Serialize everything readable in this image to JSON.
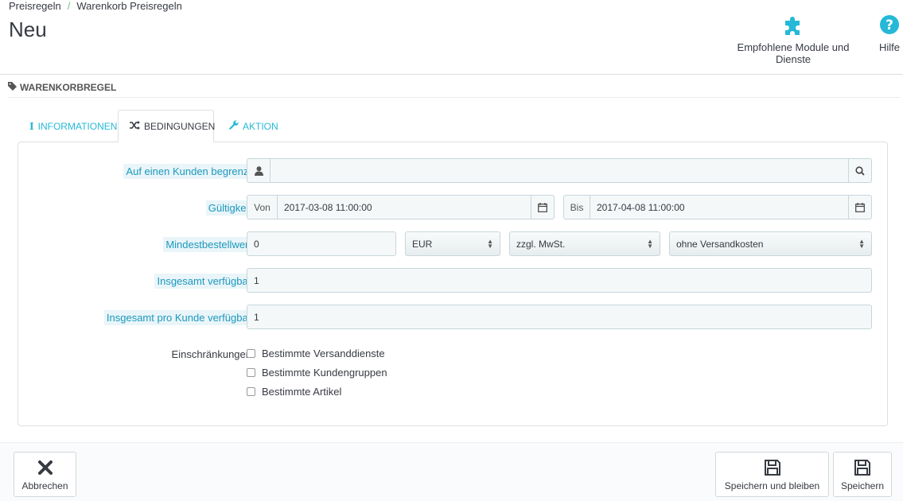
{
  "breadcrumb": {
    "item1": "Preisregeln",
    "separator": "/",
    "item2": "Warenkorb Preisregeln"
  },
  "page_title": "Neu",
  "toolbar": {
    "modules_label": "Empfohlene Module und Dienste",
    "modules_icon": "puzzle-icon",
    "help_label": "Hilfe",
    "help_icon": "help-circle-icon",
    "icon_color": "#25b9d7"
  },
  "panel": {
    "heading": "WARENKORBREGEL",
    "heading_icon": "tag-icon"
  },
  "tabs": [
    {
      "label": "INFORMATIONEN",
      "icon": "info-icon",
      "active": false
    },
    {
      "label": "BEDINGUNGEN",
      "icon": "shuffle-icon",
      "active": true
    },
    {
      "label": "AKTION",
      "icon": "wrench-icon",
      "active": false
    }
  ],
  "form": {
    "customer": {
      "label": "Auf einen Kunden begrenzt",
      "value": ""
    },
    "validity": {
      "label": "Gültigkeit",
      "from_label": "Von",
      "from_value": "2017-03-08 11:00:00",
      "to_label": "Bis",
      "to_value": "2017-04-08 11:00:00"
    },
    "min_amount": {
      "label": "Mindestbestellwert",
      "value": "0",
      "currency": "EUR",
      "tax": "zzgl. MwSt.",
      "shipping": "ohne Versandkosten"
    },
    "total_available": {
      "label": "Insgesamt verfügbar",
      "value": "1"
    },
    "per_customer": {
      "label": "Insgesamt pro Kunde verfügbar",
      "value": "1"
    },
    "restrictions": {
      "label": "Einschränkungen",
      "options": [
        {
          "label": "Bestimmte Versanddienste",
          "checked": false
        },
        {
          "label": "Bestimmte Kundengruppen",
          "checked": false
        },
        {
          "label": "Bestimmte Artikel",
          "checked": false
        }
      ]
    }
  },
  "footer": {
    "cancel_label": "Abbrechen",
    "save_stay_label": "Speichern und bleiben",
    "save_label": "Speichern"
  },
  "colors": {
    "accent": "#25b9d7",
    "label_text": "#1b99bd",
    "label_bg": "#eaf5f9"
  }
}
